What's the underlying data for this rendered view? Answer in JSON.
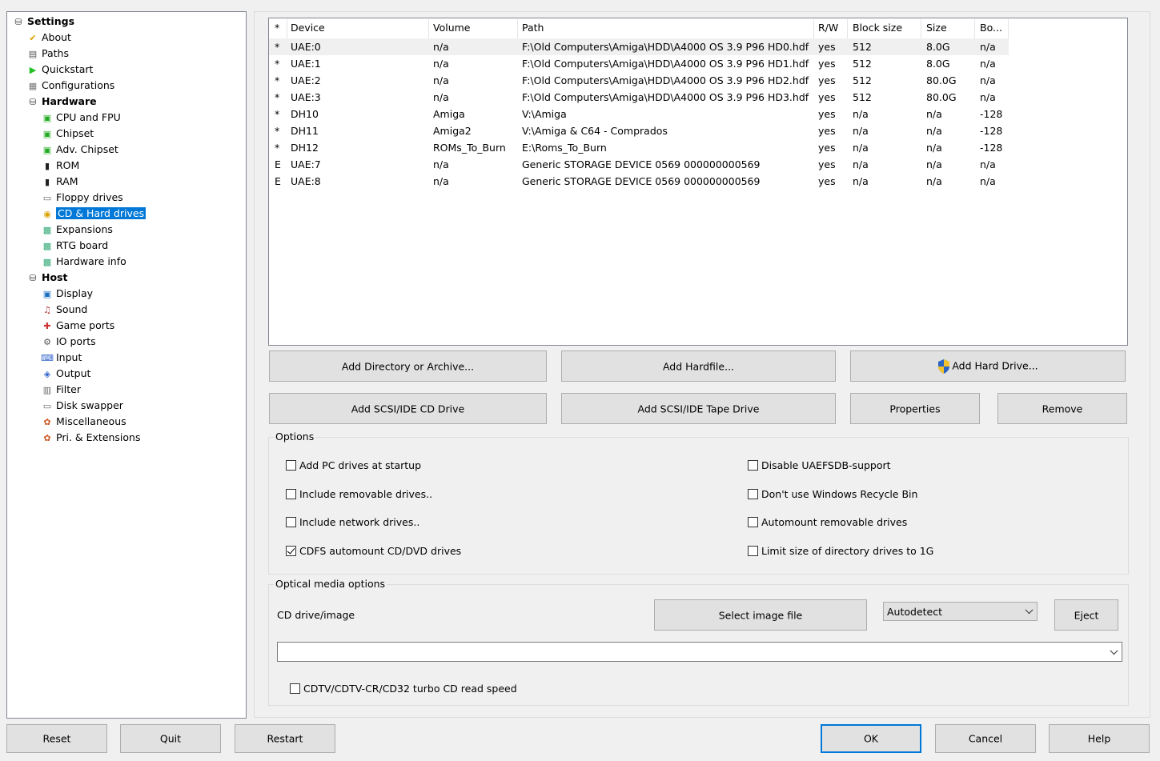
{
  "tree": [
    {
      "label": "Settings",
      "level": 0,
      "bold": true,
      "icon": "settings-disk-icon"
    },
    {
      "label": "About",
      "level": 1,
      "icon": "checkmark-icon"
    },
    {
      "label": "Paths",
      "level": 1,
      "icon": "paths-icon"
    },
    {
      "label": "Quickstart",
      "level": 1,
      "icon": "play-icon"
    },
    {
      "label": "Configurations",
      "level": 1,
      "icon": "configurations-icon"
    },
    {
      "label": "Hardware",
      "level": 1,
      "bold": true,
      "icon": "hardware-disk-icon"
    },
    {
      "label": "CPU and FPU",
      "level": 2,
      "icon": "chip-icon"
    },
    {
      "label": "Chipset",
      "level": 2,
      "icon": "chip-icon"
    },
    {
      "label": "Adv. Chipset",
      "level": 2,
      "icon": "chip-icon"
    },
    {
      "label": "ROM",
      "level": 2,
      "icon": "rom-chip-icon"
    },
    {
      "label": "RAM",
      "level": 2,
      "icon": "ram-chip-icon"
    },
    {
      "label": "Floppy drives",
      "level": 2,
      "icon": "floppy-drive-icon"
    },
    {
      "label": "CD & Hard drives",
      "level": 2,
      "icon": "hard-drive-icon",
      "selected": true
    },
    {
      "label": "Expansions",
      "level": 2,
      "icon": "expansion-card-icon"
    },
    {
      "label": "RTG board",
      "level": 2,
      "icon": "expansion-card-icon"
    },
    {
      "label": "Hardware info",
      "level": 2,
      "icon": "expansion-card-icon"
    },
    {
      "label": "Host",
      "level": 1,
      "bold": true,
      "icon": "host-disk-icon"
    },
    {
      "label": "Display",
      "level": 2,
      "icon": "display-icon"
    },
    {
      "label": "Sound",
      "level": 2,
      "icon": "sound-icon"
    },
    {
      "label": "Game ports",
      "level": 2,
      "icon": "joystick-icon"
    },
    {
      "label": "IO ports",
      "level": 2,
      "icon": "io-ports-icon"
    },
    {
      "label": "Input",
      "level": 2,
      "icon": "input-icon"
    },
    {
      "label": "Output",
      "level": 2,
      "icon": "output-icon"
    },
    {
      "label": "Filter",
      "level": 2,
      "icon": "filter-icon"
    },
    {
      "label": "Disk swapper",
      "level": 2,
      "icon": "disk-swapper-icon"
    },
    {
      "label": "Miscellaneous",
      "level": 2,
      "icon": "miscellaneous-icon"
    },
    {
      "label": "Pri. & Extensions",
      "level": 2,
      "icon": "extensions-icon"
    }
  ],
  "table": {
    "columns": [
      "*",
      "Device",
      "Volume",
      "Path",
      "R/W",
      "Block size",
      "Size",
      "Bo..."
    ],
    "rows": [
      [
        "*",
        "UAE:0",
        "n/a",
        "F:\\Old Computers\\Amiga\\HDD\\A4000 OS 3.9 P96 HD0.hdf",
        "yes",
        "512",
        "8.0G",
        "n/a"
      ],
      [
        "*",
        "UAE:1",
        "n/a",
        "F:\\Old Computers\\Amiga\\HDD\\A4000 OS 3.9 P96 HD1.hdf",
        "yes",
        "512",
        "8.0G",
        "n/a"
      ],
      [
        "*",
        "UAE:2",
        "n/a",
        "F:\\Old Computers\\Amiga\\HDD\\A4000 OS 3.9 P96 HD2.hdf",
        "yes",
        "512",
        "80.0G",
        "n/a"
      ],
      [
        "*",
        "UAE:3",
        "n/a",
        "F:\\Old Computers\\Amiga\\HDD\\A4000 OS 3.9 P96 HD3.hdf",
        "yes",
        "512",
        "80.0G",
        "n/a"
      ],
      [
        "*",
        "DH10",
        "Amiga",
        "V:\\Amiga",
        "yes",
        "n/a",
        "n/a",
        "-128"
      ],
      [
        "*",
        "DH11",
        "Amiga2",
        "V:\\Amiga & C64 - Comprados",
        "yes",
        "n/a",
        "n/a",
        "-128"
      ],
      [
        "*",
        "DH12",
        "ROMs_To_Burn",
        "E:\\Roms_To_Burn",
        "yes",
        "n/a",
        "n/a",
        "-128"
      ],
      [
        "E",
        "UAE:7",
        "n/a",
        "Generic STORAGE DEVICE 0569 000000000569",
        "yes",
        "n/a",
        "n/a",
        "n/a"
      ],
      [
        "E",
        "UAE:8",
        "n/a",
        "Generic STORAGE DEVICE 0569 000000000569",
        "yes",
        "n/a",
        "n/a",
        "n/a"
      ]
    ]
  },
  "buttons": {
    "add_dir": "Add Directory or Archive...",
    "add_hardfile": "Add Hardfile...",
    "add_hard_drive": "Add Hard Drive...",
    "add_cd": "Add SCSI/IDE CD Drive",
    "add_tape": "Add SCSI/IDE Tape Drive",
    "properties": "Properties",
    "remove": "Remove"
  },
  "options": {
    "title": "Options",
    "items": [
      {
        "label": "Add PC drives at startup",
        "checked": false
      },
      {
        "label": "Include removable drives..",
        "checked": false
      },
      {
        "label": "Include network drives..",
        "checked": false
      },
      {
        "label": "CDFS automount CD/DVD drives",
        "checked": true
      },
      {
        "label": "Disable UAEFSDB-support",
        "checked": false
      },
      {
        "label": "Don't use Windows Recycle Bin",
        "checked": false
      },
      {
        "label": "Automount removable drives",
        "checked": false
      },
      {
        "label": "Limit size of directory drives to 1G",
        "checked": false
      }
    ]
  },
  "optical": {
    "title": "Optical media options",
    "cd_label": "CD drive/image",
    "select_image": "Select image file",
    "mode": "Autodetect",
    "eject": "Eject",
    "path_value": "",
    "turbo_label": "CDTV/CDTV-CR/CD32 turbo CD read speed",
    "turbo_checked": false
  },
  "footer": {
    "reset": "Reset",
    "quit": "Quit",
    "restart": "Restart",
    "ok": "OK",
    "cancel": "Cancel",
    "help": "Help"
  },
  "colors": {
    "selection": "#0078d7",
    "ok_border": "#0078d7"
  }
}
